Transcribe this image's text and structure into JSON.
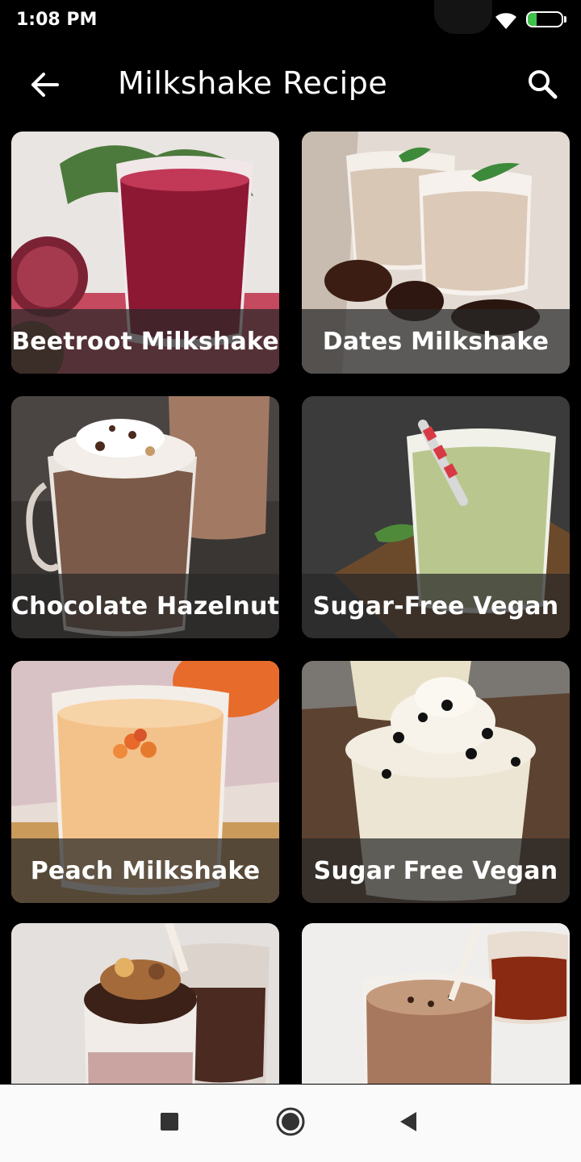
{
  "status_bar": {
    "time": "1:08 PM",
    "battery_level": "27",
    "battery_fraction": 0.27,
    "battery_color": "#3fc24a",
    "wifi_icon": "wifi-icon"
  },
  "app_bar": {
    "title": "Milkshake Recipe",
    "back_icon": "arrow-left-icon",
    "search_icon": "search-icon"
  },
  "recipes": [
    {
      "name": "Beetroot Milkshake"
    },
    {
      "name": "Dates Milkshake"
    },
    {
      "name": "Chocolate Hazelnut"
    },
    {
      "name": "Sugar-Free Vegan"
    },
    {
      "name": "Peach Milkshake"
    },
    {
      "name": "Sugar Free Vegan"
    },
    {
      "name": ""
    },
    {
      "name": ""
    }
  ],
  "nav_bar": {
    "recents_icon": "square-icon",
    "home_icon": "circle-icon",
    "back_icon": "triangle-back-icon"
  },
  "colors": {
    "background": "#000000",
    "nav_background": "#fafafa",
    "label_overlay": "#282828"
  }
}
